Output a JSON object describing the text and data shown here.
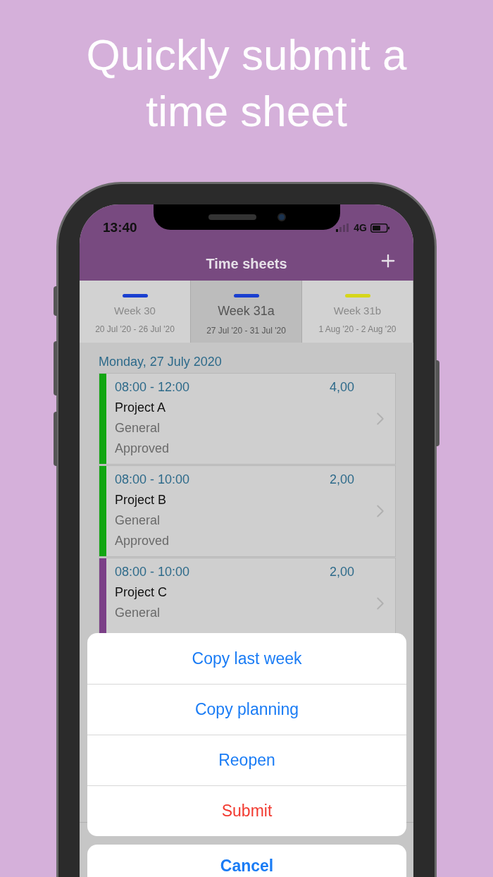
{
  "headline": "Quickly submit a time sheet",
  "status_bar": {
    "time": "13:40",
    "network": "4G"
  },
  "nav": {
    "title": "Time sheets"
  },
  "tabs": [
    {
      "label": "Week 30",
      "dates": "20 Jul '20 - 26 Jul '20",
      "color": "#1a3fd0",
      "selected": false
    },
    {
      "label": "Week 31a",
      "dates": "27 Jul '20 - 31 Jul '20",
      "color": "#1a3fd0",
      "selected": true
    },
    {
      "label": "Week 31b",
      "dates": "1 Aug '20 - 2 Aug '20",
      "color": "#d6d61a",
      "selected": false
    }
  ],
  "day_header": "Monday, 27 July 2020",
  "entries": [
    {
      "time": "08:00 - 12:00",
      "hours": "4,00",
      "project": "Project A",
      "category": "General",
      "status": "Approved",
      "color": "#12a612"
    },
    {
      "time": "08:00 - 10:00",
      "hours": "2,00",
      "project": "Project B",
      "category": "General",
      "status": "Approved",
      "color": "#12a612"
    },
    {
      "time": "08:00 - 10:00",
      "hours": "2,00",
      "project": "Project C",
      "category": "General",
      "color": "#7b3f87"
    }
  ],
  "action_sheet": {
    "actions": [
      {
        "label": "Copy last week",
        "kind": "default"
      },
      {
        "label": "Copy planning",
        "kind": "default"
      },
      {
        "label": "Reopen",
        "kind": "default"
      },
      {
        "label": "Submit",
        "kind": "destructive"
      }
    ],
    "cancel": "Cancel"
  }
}
